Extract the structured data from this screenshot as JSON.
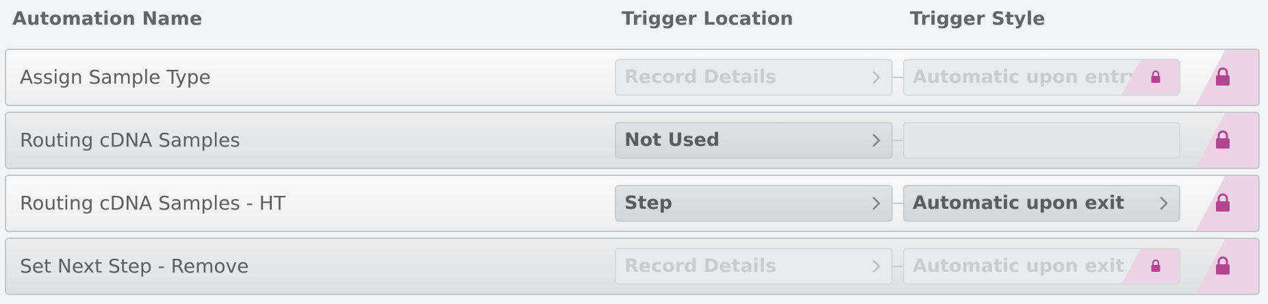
{
  "headers": {
    "automation_name": "Automation Name",
    "trigger_location": "Trigger Location",
    "trigger_style": "Trigger Style"
  },
  "colors": {
    "lock_accent": "#b0468f",
    "lock_band": "#ecd3e6"
  },
  "rows": [
    {
      "name": "Assign Sample Type",
      "trigger_location": "Record Details",
      "trigger_location_state": "disabled",
      "trigger_style": "Automatic upon entry",
      "trigger_style_state": "locked",
      "row_lock_icon": "lock-icon"
    },
    {
      "name": "Routing cDNA Samples",
      "trigger_location": "Not Used",
      "trigger_location_state": "active",
      "trigger_style": "",
      "trigger_style_state": "empty",
      "row_lock_icon": "lock-icon"
    },
    {
      "name": "Routing cDNA Samples - HT",
      "trigger_location": "Step",
      "trigger_location_state": "active",
      "trigger_style": "Automatic upon exit",
      "trigger_style_state": "active",
      "row_lock_icon": "lock-icon"
    },
    {
      "name": "Set Next Step - Remove",
      "trigger_location": "Record Details",
      "trigger_location_state": "disabled",
      "trigger_style": "Automatic upon exit",
      "trigger_style_state": "locked",
      "row_lock_icon": "lock-icon"
    }
  ]
}
